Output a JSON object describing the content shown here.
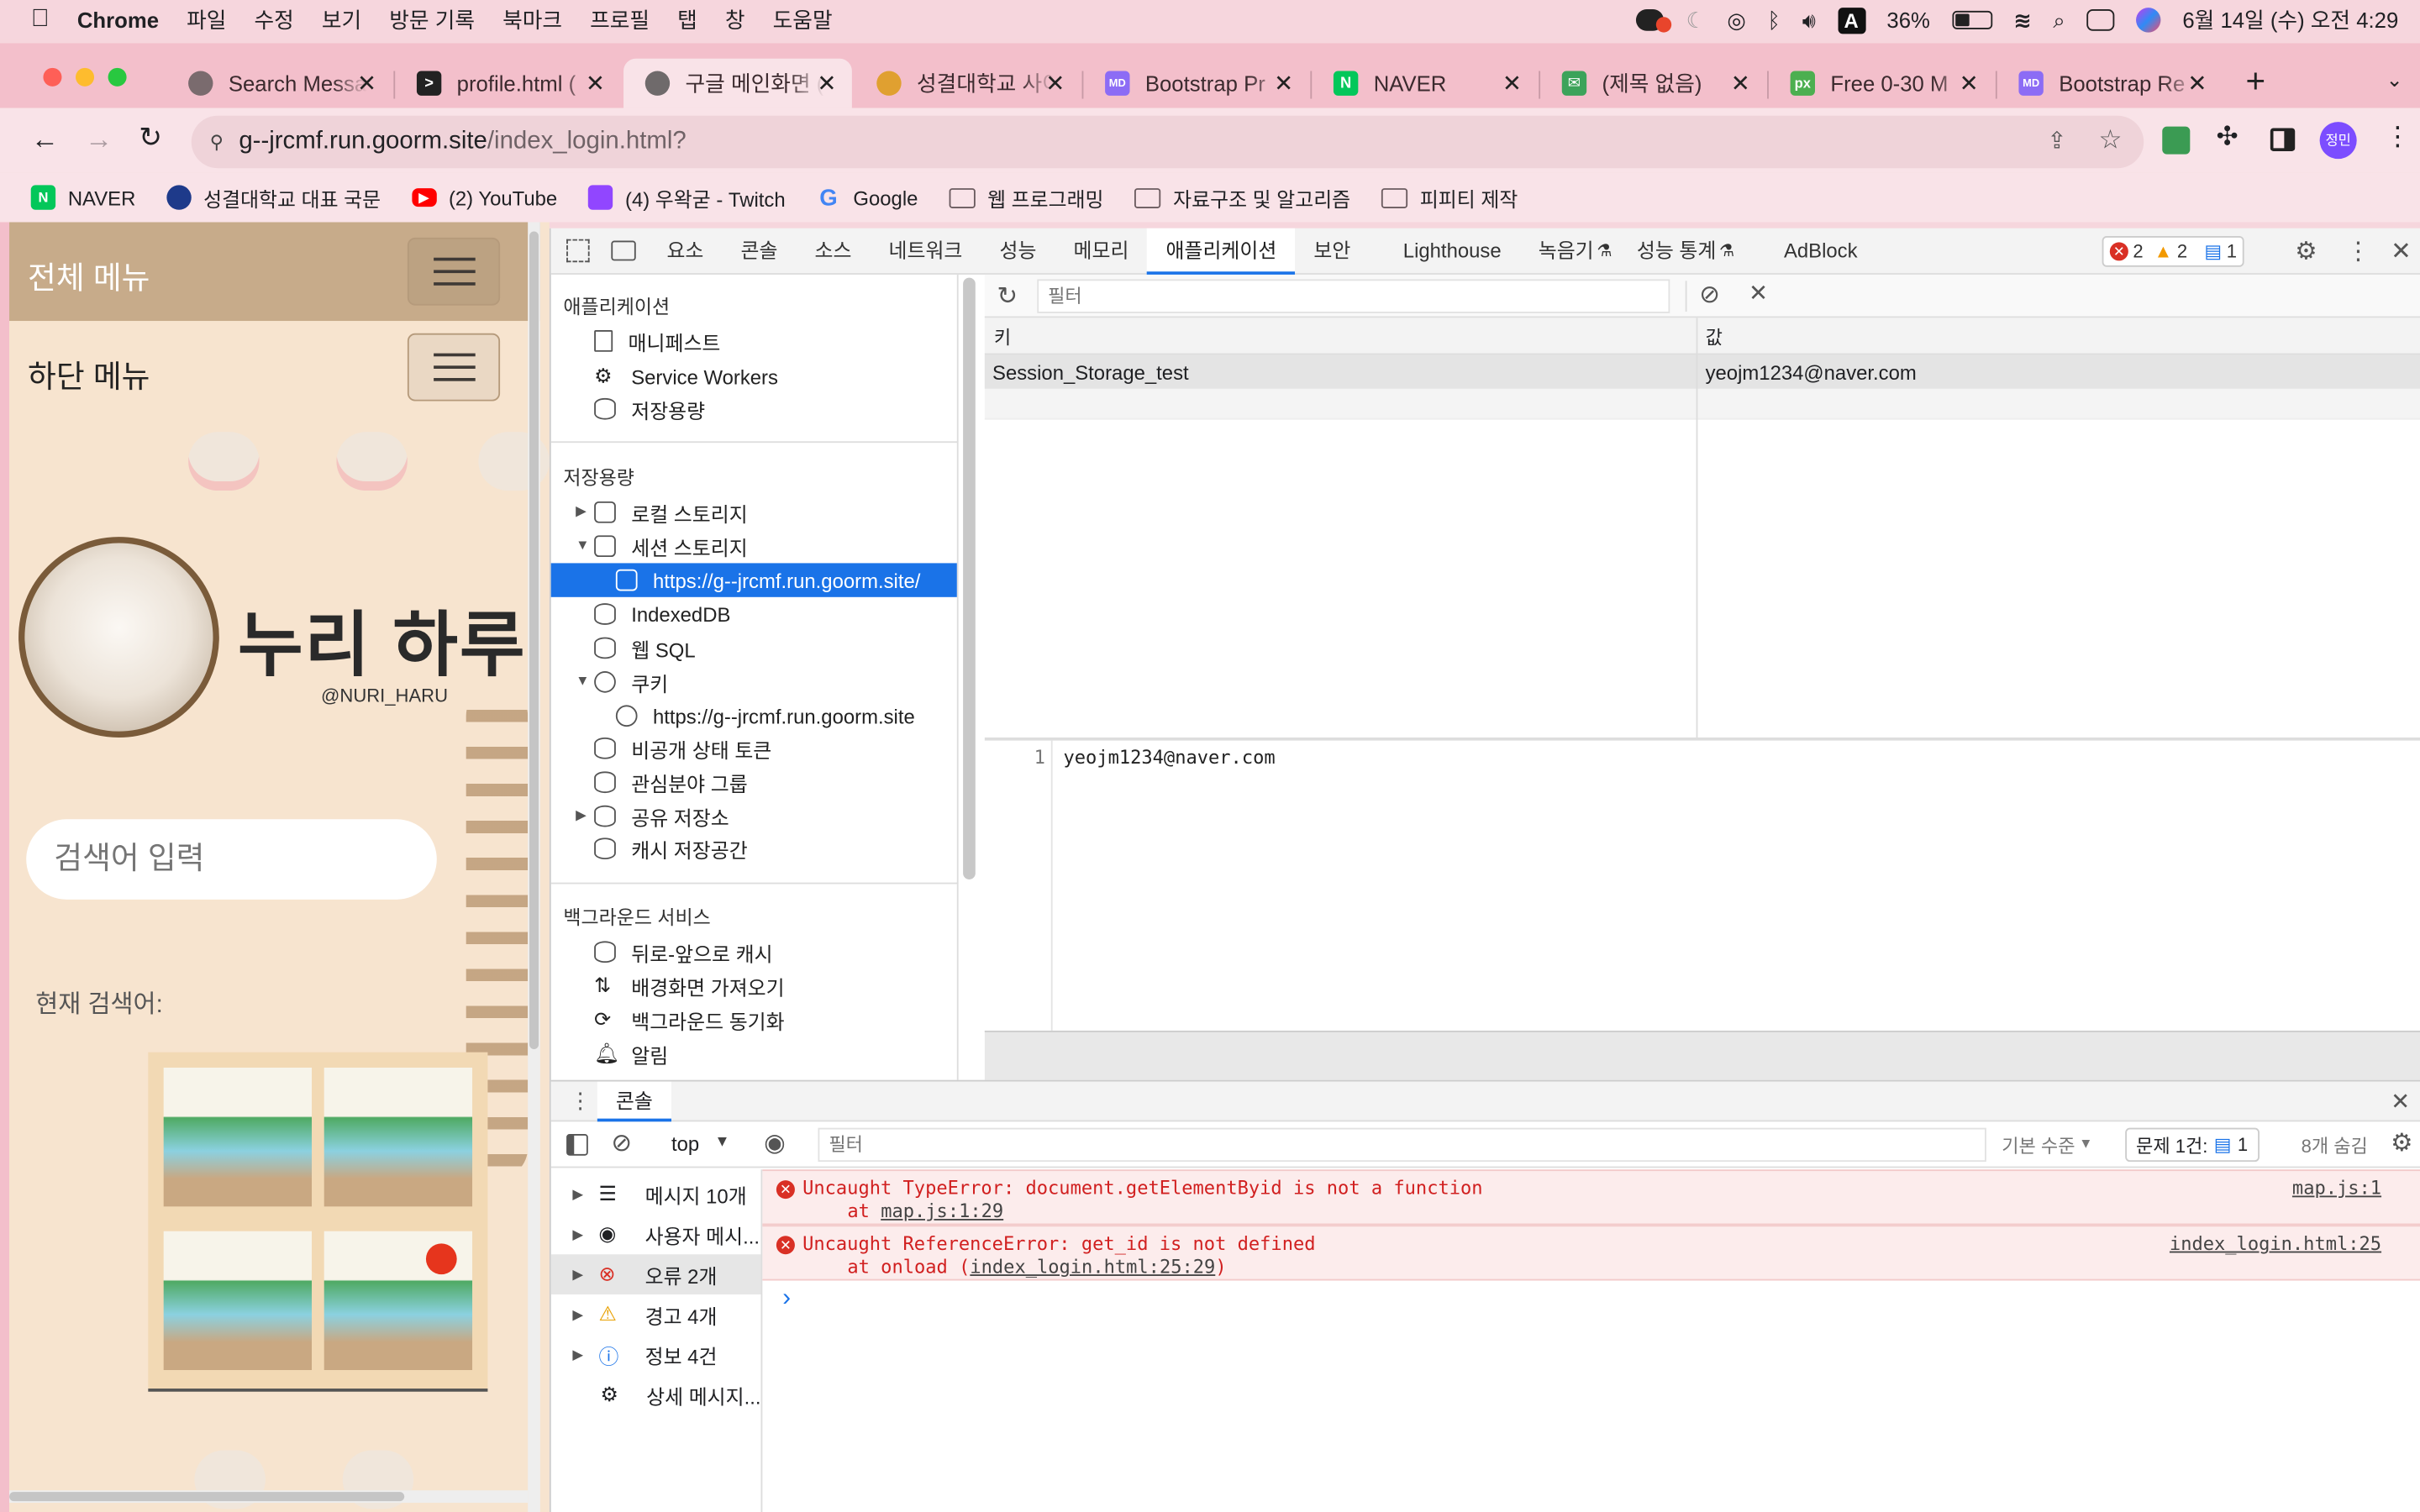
{
  "menubar": {
    "app": "Chrome",
    "items": [
      "파일",
      "수정",
      "보기",
      "방문 기록",
      "북마크",
      "프로필",
      "탭",
      "창",
      "도움말"
    ],
    "battery": "36%",
    "datetime": "6월 14일 (수) 오전 4:29",
    "input_source": "A"
  },
  "tabs": [
    {
      "title": "Search Messages",
      "icon": "chatgpt-icon"
    },
    {
      "title": "profile.html (",
      "icon": "terminal-icon"
    },
    {
      "title": "구글 메인화면 (",
      "icon": "globe-icon"
    },
    {
      "title": "성결대학교 사이",
      "icon": "university-icon"
    },
    {
      "title": "Bootstrap Pr",
      "icon": "bootstrap-icon"
    },
    {
      "title": "NAVER",
      "icon": "naver-icon"
    },
    {
      "title": "(제목 없음)",
      "icon": "document-icon"
    },
    {
      "title": "Free 0-30 M",
      "icon": "px-icon"
    },
    {
      "title": "Bootstrap Re",
      "icon": "bootstrap-icon"
    }
  ],
  "address": {
    "host": "g--jrcmf.run.goorm.site",
    "path": "/index_login.html?"
  },
  "profile_badge": "정민",
  "bookmarks": [
    {
      "label": "NAVER",
      "icon": "naver-icon"
    },
    {
      "label": "성결대학교 대표 국문",
      "icon": "university-icon"
    },
    {
      "label": "(2) YouTube",
      "icon": "youtube-icon"
    },
    {
      "label": "(4) 우왁굳 - Twitch",
      "icon": "twitch-icon"
    },
    {
      "label": "Google",
      "icon": "google-icon"
    },
    {
      "label": "웹 프로그래밍",
      "icon": "folder-icon"
    },
    {
      "label": "자료구조 및 알고리즘",
      "icon": "folder-icon"
    },
    {
      "label": "피피티 제작",
      "icon": "folder-icon"
    }
  ],
  "site": {
    "top_menu": "전체 메뉴",
    "bottom_menu": "하단 메뉴",
    "title": "누리 하루",
    "handle": "@NURI_HARU",
    "search_placeholder": "검색어 입력",
    "current_search_label": "현재 검색어:"
  },
  "devtools": {
    "tabs": [
      "요소",
      "콘솔",
      "소스",
      "네트워크",
      "성능",
      "메모리",
      "애플리케이션",
      "보안",
      "Lighthouse",
      "녹음기",
      "성능 통계",
      "AdBlock"
    ],
    "active_tab": "애플리케이션",
    "counts": {
      "errors": "2",
      "warnings": "2",
      "info": "1"
    },
    "sidebar": {
      "app_header": "애플리케이션",
      "app_items": [
        "매니페스트",
        "Service Workers",
        "저장용량"
      ],
      "storage_header": "저장용량",
      "storage_items": [
        "로컬 스토리지",
        "세션 스토리지",
        "https://g--jrcmf.run.goorm.site/",
        "IndexedDB",
        "웹 SQL",
        "쿠키",
        "https://g--jrcmf.run.goorm.site",
        "비공개 상태 토큰",
        "관심분야 그룹",
        "공유 저장소",
        "캐시 저장공간"
      ],
      "bg_header": "백그라운드 서비스",
      "bg_items": [
        "뒤로-앞으로 캐시",
        "배경화면 가져오기",
        "백그라운드 동기화",
        "알림"
      ]
    },
    "filter_placeholder": "필터",
    "table": {
      "headers": [
        "키",
        "값"
      ],
      "rows": [
        {
          "key": "Session_Storage_test",
          "value": "yeojm1234@naver.com"
        }
      ]
    },
    "preview": {
      "line": "1",
      "text": "yeojm1234@naver.com"
    }
  },
  "console": {
    "drawer_title": "콘솔",
    "context": "top",
    "filter_placeholder": "필터",
    "level": "기본 수준",
    "issues": "문제 1건:",
    "issues_count": "1",
    "hidden": "8개 숨김",
    "sidebar": [
      "메시지 10개",
      "사용자 메시...",
      "오류 2개",
      "경고 4개",
      "정보 4건",
      "상세 메시지..."
    ],
    "errors": [
      {
        "message": "Uncaught TypeError: document.getElementByid is not a function",
        "at": "at ",
        "at_link": "map.js:1:29",
        "source": "map.js:1",
        "suffix": ""
      },
      {
        "message": "Uncaught ReferenceError: get_id is not defined",
        "at": "at onload (",
        "at_link": "index_login.html:25:29",
        "source": "index_login.html:25",
        "suffix": ")"
      }
    ],
    "prompt": "›"
  },
  "colors": {
    "tabbar": "#f3bfcb",
    "toolbar": "#f9e3e8",
    "selected": "#1a73e8",
    "error": "#d93025"
  }
}
